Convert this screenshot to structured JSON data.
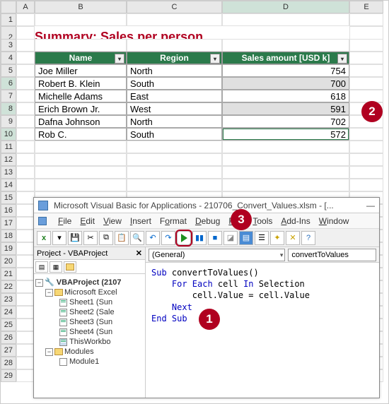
{
  "columns": [
    "A",
    "B",
    "C",
    "D",
    "E"
  ],
  "title": "Summary: Sales per person",
  "table": {
    "headers": [
      "Name",
      "Region",
      "Sales amount [USD k]"
    ],
    "rows": [
      {
        "name": "Joe Miller",
        "region": "North",
        "amount": "754",
        "shade": false
      },
      {
        "name": "Robert B. Klein",
        "region": "South",
        "amount": "700",
        "shade": true
      },
      {
        "name": "Michelle Adams",
        "region": "East",
        "amount": "618",
        "shade": false
      },
      {
        "name": "Erich Brown Jr.",
        "region": "West",
        "amount": "591",
        "shade": true
      },
      {
        "name": "Dafna Johnson",
        "region": "North",
        "amount": "702",
        "shade": false
      },
      {
        "name": "Rob C.",
        "region": "South",
        "amount": "572",
        "shade": false
      }
    ]
  },
  "vbe": {
    "title": "Microsoft Visual Basic for Applications - 210706_Convert_Values.xlsm - [...",
    "menu": [
      "File",
      "Edit",
      "View",
      "Insert",
      "Format",
      "Debug",
      "Run",
      "Tools",
      "Add-Ins",
      "Window"
    ],
    "projectPane": "Project - VBAProject",
    "tree": {
      "root": "VBAProject (2107",
      "excelFolder": "Microsoft Excel",
      "sheets": [
        "Sheet1 (Sun",
        "Sheet2 (Sale",
        "Sheet3 (Sun",
        "Sheet4 (Sun"
      ],
      "workbook": "ThisWorkbo",
      "modulesFolder": "Modules",
      "module": "Module1"
    },
    "dropdownLeft": "(General)",
    "dropdownRight": "convertToValues",
    "code": {
      "l1a": "Sub",
      "l1b": " convertToValues()",
      "l2a": "For Each",
      "l2b": " cell ",
      "l2c": "In",
      "l2d": " Selection",
      "l3": "cell.Value = cell.Value",
      "l4": "Next",
      "l5": "End Sub"
    }
  },
  "badges": {
    "b1": "1",
    "b2": "2",
    "b3": "3"
  }
}
